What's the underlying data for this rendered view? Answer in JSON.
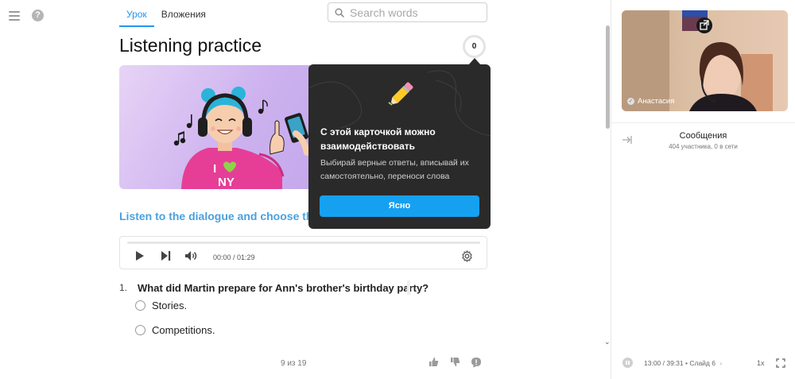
{
  "rail": {
    "menu_icon": "hamburger-icon",
    "help_label": "?"
  },
  "tabs": [
    {
      "label": "Урок",
      "active": true
    },
    {
      "label": "Вложения",
      "active": false
    }
  ],
  "search": {
    "placeholder": "Search words",
    "value": ""
  },
  "lesson": {
    "title": "Listening practice",
    "score": "0",
    "task_title": "Listen to the dialogue and choose the"
  },
  "player": {
    "time": "00:00 / 01:29",
    "progress": 0,
    "icons": [
      "play-icon",
      "skip-next-icon",
      "volume-icon",
      "settings-icon"
    ]
  },
  "question": {
    "number": "1.",
    "text": "What did Martin prepare for Ann's brother's birthday party?",
    "options": [
      "Stories.",
      "Competitions."
    ]
  },
  "footer": {
    "pager": "9 из 19",
    "icons": [
      "thumbs-up-icon",
      "thumbs-down-icon",
      "comment-icon"
    ]
  },
  "popover": {
    "title": "С этой карточкой можно взаимодействовать",
    "text": "Выбирай верные ответы, вписывай их самостоятельно, переноси слова",
    "button": "Ясно",
    "icon": "pencil-icon"
  },
  "sidebar": {
    "participant_name": "Анастасия",
    "chat_title": "Сообщения",
    "chat_subtitle": "404 участника, 0 в сети",
    "recording_time": "13:00 / 39:31",
    "slide": "• Слайд 6",
    "speed": "1x"
  },
  "colors": {
    "accent": "#2196f3",
    "task_title": "#4aa0de",
    "popover_bg": "#2a2a2a",
    "popover_button": "#16a0f0"
  }
}
